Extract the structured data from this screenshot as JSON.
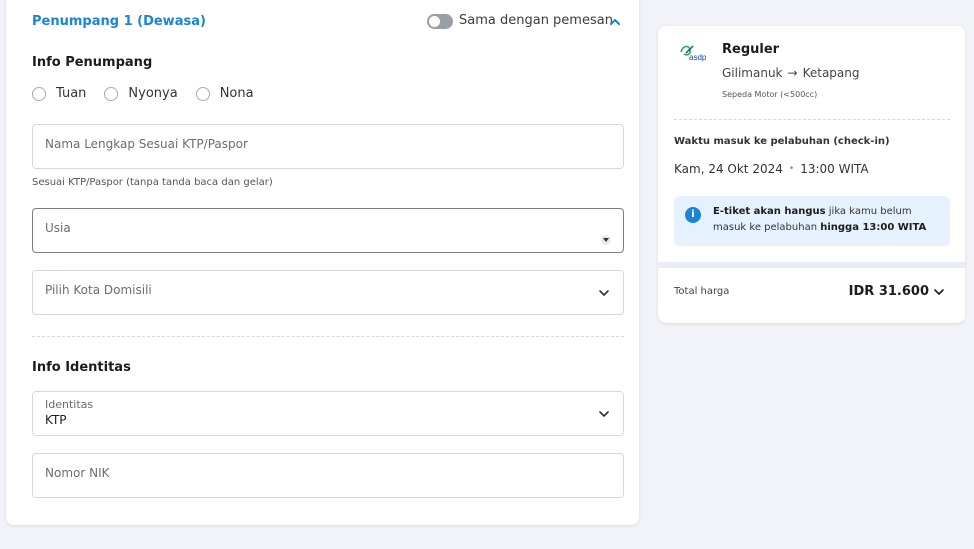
{
  "passenger": {
    "title": "Penumpang 1 (Dewasa)",
    "toggle_label": "Sama dengan pemesan",
    "info_heading": "Info Penumpang",
    "salutations": [
      "Tuan",
      "Nyonya",
      "Nona"
    ],
    "full_name_placeholder": "Nama Lengkap Sesuai KTP/Paspor",
    "full_name_helper": "Sesuai KTP/Paspor (tanpa tanda baca dan gelar)",
    "age_placeholder": "Usia",
    "city_placeholder": "Pilih Kota Domisili",
    "identity_heading": "Info Identitas",
    "identity_label": "Identitas",
    "identity_value": "KTP",
    "nik_placeholder": "Nomor NIK"
  },
  "summary": {
    "logo_text": "asdp",
    "product": "Reguler",
    "origin": "Gilimanuk",
    "arrow": "→",
    "destination": "Ketapang",
    "vehicle": "Sepeda Motor (<500cc)",
    "checkin_label": "Waktu masuk ke pelabuhan (check-in)",
    "checkin_date": "Kam, 24 Okt 2024",
    "checkin_sep": "•",
    "checkin_time": "13:00 WITA",
    "notice_bold1": "E-tiket akan hangus",
    "notice_text": " jika kamu belum masuk ke pelabuhan ",
    "notice_bold2": "hingga 13:00 WITA",
    "total_label": "Total harga",
    "total_value": "IDR 31.600"
  },
  "colors": {
    "accent": "#1b84d6",
    "background": "#f2f3f8",
    "info_bg": "#e5f2fd"
  }
}
